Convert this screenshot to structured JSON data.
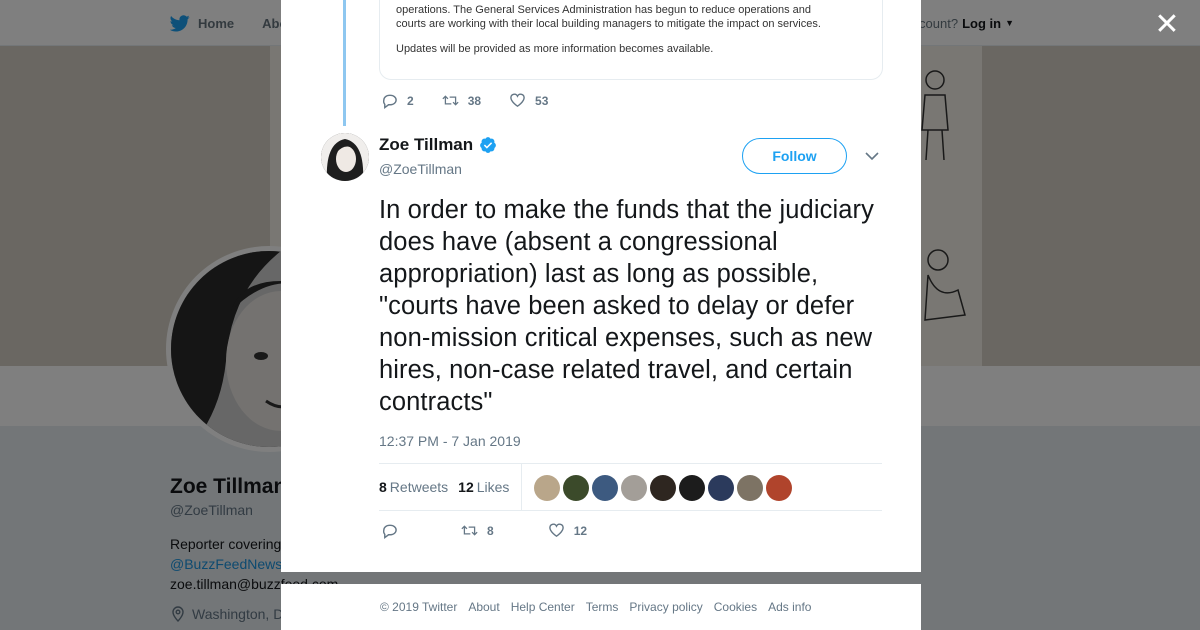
{
  "topbar": {
    "home_label": "Home",
    "about_label": "Abo",
    "account_text": "ccount?",
    "login_label": "Log in"
  },
  "profile": {
    "name": "Zoe Tillman",
    "handle": "@ZoeTillman",
    "bio_line1": "Reporter covering",
    "bio_link": "@BuzzFeedNews",
    "bio_line3": "zoe.tillman@buzzfeed.com",
    "location": "Washington, D"
  },
  "quoted_tweet": {
    "para1_line1": "operations. The General Services Administration has begun to reduce operations and",
    "para1_line2": "courts are working with their local building managers to mitigate the impact on services.",
    "para2": "Updates will be provided as more information becomes available."
  },
  "previous_tweet_actions": {
    "replies": "2",
    "retweets": "38",
    "likes": "53"
  },
  "tweet": {
    "author_name": "Zoe Tillman",
    "author_handle": "@ZoeTillman",
    "follow_label": "Follow",
    "text": "In order to make the funds that the judiciary does have (absent a congressional appropriation) last as long as possible, \"courts have been asked to delay or defer non-mission critical expenses, such as new hires, non-case related travel, and certain contracts\"",
    "timestamp": "12:37 PM - 7 Jan 2019",
    "retweet_count": "8",
    "retweet_label": "Retweets",
    "like_count": "12",
    "like_label": "Likes",
    "actions": {
      "replies": "",
      "retweets": "8",
      "likes": "12"
    }
  },
  "likers": [
    {
      "name": "liker-1",
      "color": "#b9a68a"
    },
    {
      "name": "liker-2",
      "color": "#3b4a2a"
    },
    {
      "name": "liker-3",
      "color": "#3d5a80"
    },
    {
      "name": "liker-4",
      "color": "#a39e98"
    },
    {
      "name": "liker-5",
      "color": "#2e2620"
    },
    {
      "name": "liker-6",
      "color": "#1c1c1c"
    },
    {
      "name": "liker-7",
      "color": "#2b3a5c"
    },
    {
      "name": "liker-8",
      "color": "#7d7364"
    },
    {
      "name": "liker-9",
      "color": "#b0442c"
    }
  ],
  "footer": {
    "copyright": "© 2019 Twitter",
    "about": "About",
    "help": "Help Center",
    "terms": "Terms",
    "privacy": "Privacy policy",
    "cookies": "Cookies",
    "ads": "Ads info"
  },
  "colors": {
    "twitter_blue": "#1da1f2",
    "thread_line": "#8ec7f0",
    "muted_text": "#657786"
  }
}
